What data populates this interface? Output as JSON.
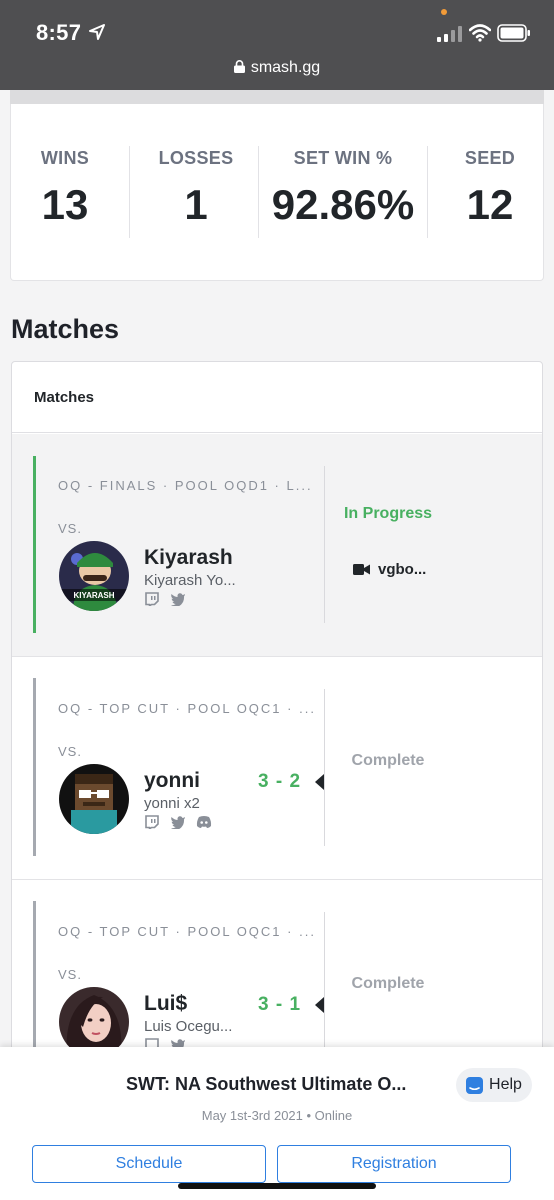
{
  "status_bar": {
    "time": "8:57"
  },
  "browser": {
    "url": "smash.gg"
  },
  "stats": [
    {
      "label": "WINS",
      "value": "13"
    },
    {
      "label": "LOSSES",
      "value": "1"
    },
    {
      "label": "SET WIN %",
      "value": "92.86%"
    },
    {
      "label": "SEED",
      "value": "12"
    }
  ],
  "section_title": "Matches",
  "matches_header": "Matches",
  "matches": [
    {
      "round": "OQ - FINALS · POOL OQD1 · L...",
      "vs": "VS.",
      "gamer_tag": "Kiyarash",
      "real_name": "Kiyarash Yo...",
      "avatar_text": "KIYARASH",
      "score": "",
      "status": "In Progress",
      "stream": "vgbo..."
    },
    {
      "round": "OQ - TOP CUT · POOL OQC1 · ...",
      "vs": "VS.",
      "gamer_tag": "yonni",
      "real_name": "yonni x2",
      "score": "3 - 2",
      "status": "Complete"
    },
    {
      "round": "OQ - TOP CUT · POOL OQC1 · ...",
      "vs": "VS.",
      "gamer_tag": "Lui$",
      "real_name": "Luis Ocegu...",
      "score": "3 - 1",
      "status": "Complete"
    }
  ],
  "event": {
    "title": "SWT: NA Southwest Ultimate O...",
    "meta": "May 1st-3rd 2021 • Online",
    "help_label": "Help",
    "schedule_label": "Schedule",
    "registration_label": "Registration"
  },
  "colors": {
    "accent_blue": "#2f7fe0",
    "in_progress_green": "#48b061",
    "complete_grey": "#a0a4ab",
    "topbar": "#4f4f51"
  }
}
